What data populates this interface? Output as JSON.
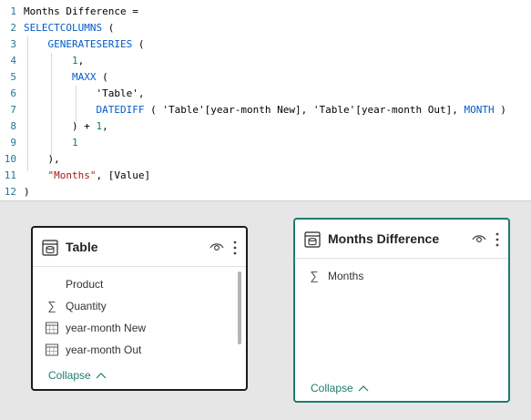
{
  "editor": {
    "lines": [
      {
        "n": "1",
        "parts": [
          {
            "t": "Months Difference =",
            "c": ""
          }
        ]
      },
      {
        "n": "2",
        "parts": [
          {
            "t": "SELECTCOLUMNS",
            "c": "kw"
          },
          {
            "t": " (",
            "c": ""
          }
        ]
      },
      {
        "n": "3",
        "parts": [
          {
            "t": "    GENERATESERIES",
            "c": "kw"
          },
          {
            "t": " (",
            "c": ""
          }
        ]
      },
      {
        "n": "4",
        "parts": [
          {
            "t": "        ",
            "c": ""
          },
          {
            "t": "1",
            "c": "num"
          },
          {
            "t": ",",
            "c": ""
          }
        ]
      },
      {
        "n": "5",
        "parts": [
          {
            "t": "        MAXX",
            "c": "kw"
          },
          {
            "t": " (",
            "c": ""
          }
        ]
      },
      {
        "n": "6",
        "parts": [
          {
            "t": "            ",
            "c": ""
          },
          {
            "t": "'Table'",
            "c": ""
          },
          {
            "t": ",",
            "c": ""
          }
        ]
      },
      {
        "n": "7",
        "parts": [
          {
            "t": "            DATEDIFF",
            "c": "kw"
          },
          {
            "t": " ( 'Table'[year-month New], 'Table'[year-month Out], ",
            "c": ""
          },
          {
            "t": "MONTH",
            "c": "kw"
          },
          {
            "t": " )",
            "c": ""
          }
        ]
      },
      {
        "n": "8",
        "parts": [
          {
            "t": "        ) + ",
            "c": ""
          },
          {
            "t": "1",
            "c": "num"
          },
          {
            "t": ",",
            "c": ""
          }
        ]
      },
      {
        "n": "9",
        "parts": [
          {
            "t": "        ",
            "c": ""
          },
          {
            "t": "1",
            "c": "num"
          }
        ]
      },
      {
        "n": "10",
        "parts": [
          {
            "t": "    ),",
            "c": ""
          }
        ]
      },
      {
        "n": "11",
        "parts": [
          {
            "t": "    ",
            "c": ""
          },
          {
            "t": "\"Months\"",
            "c": "str"
          },
          {
            "t": ", [Value]",
            "c": ""
          }
        ]
      },
      {
        "n": "12",
        "parts": [
          {
            "t": ")",
            "c": ""
          }
        ]
      }
    ]
  },
  "table_card": {
    "title": "Table",
    "fields": [
      {
        "label": "Product",
        "icon": "none"
      },
      {
        "label": "Quantity",
        "icon": "sigma"
      },
      {
        "label": "year-month New",
        "icon": "calendar"
      },
      {
        "label": "year-month Out",
        "icon": "calendar"
      }
    ],
    "collapse_label": "Collapse"
  },
  "months_card": {
    "title": "Months Difference",
    "fields": [
      {
        "label": "Months",
        "icon": "sigma"
      }
    ],
    "collapse_label": "Collapse"
  },
  "colors": {
    "accent": "#1d7d6c",
    "keyword": "#035aca",
    "string": "#a31515",
    "number": "#098658",
    "line_number": "#237893"
  }
}
